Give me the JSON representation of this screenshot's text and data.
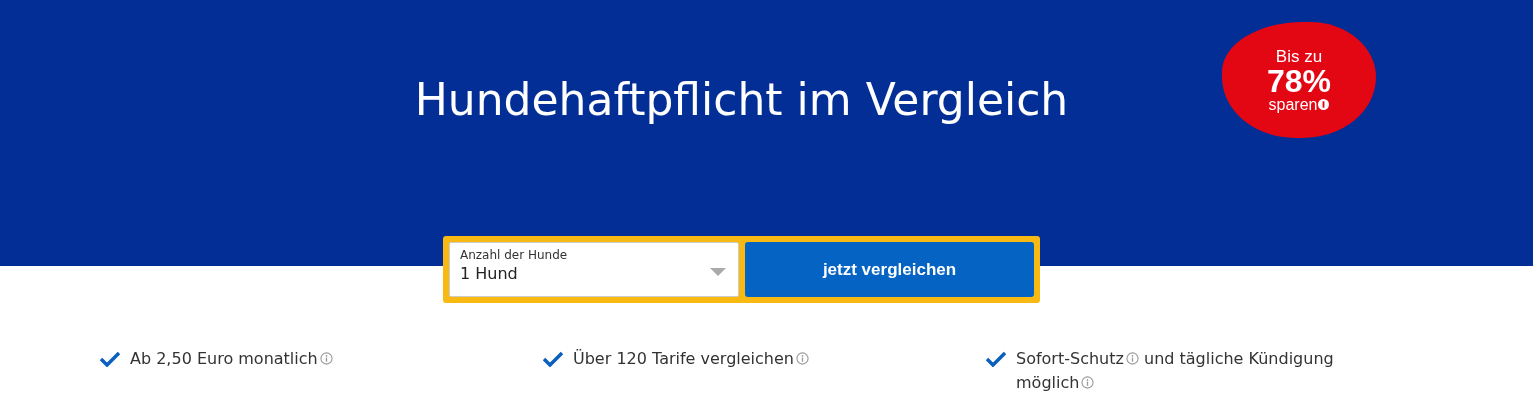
{
  "hero": {
    "title": "Hundehaftpflicht im Vergleich",
    "badge": {
      "line_1": "Bis zu",
      "value": "78%",
      "line_3": "sparen"
    }
  },
  "form": {
    "select": {
      "label": "Anzahl der Hunde",
      "value": "1 Hund"
    },
    "button": "jetzt vergleichen"
  },
  "features": [
    {
      "parts": [
        {
          "text": "Ab 2,50 Euro monatlich",
          "info": true
        }
      ]
    },
    {
      "parts": [
        {
          "text": "Über 120 Tarife vergleichen",
          "info": true
        }
      ]
    },
    {
      "parts": [
        {
          "text": "Sofort-Schutz",
          "info": true
        },
        {
          "text": "und tägliche Kündigung",
          "info": false
        },
        {
          "text": "möglich",
          "info": true
        }
      ]
    }
  ]
}
